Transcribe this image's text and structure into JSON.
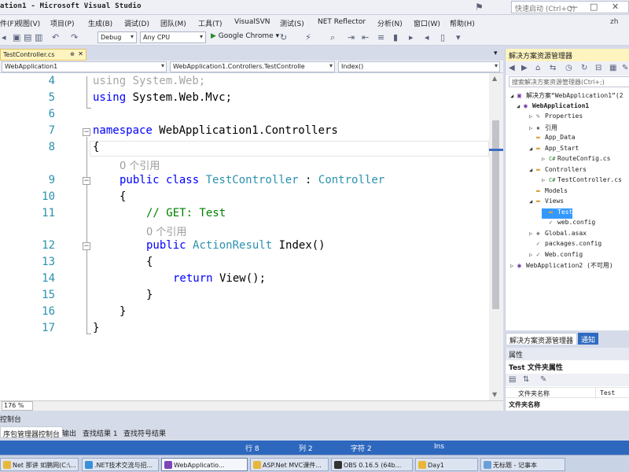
{
  "window": {
    "title": "ation1 - Microsoft Visual Studio",
    "quick_launch_placeholder": "快速启动 (Ctrl+Q)",
    "controls": [
      "—",
      "□",
      "✕"
    ]
  },
  "menu": {
    "items": [
      "件(F)",
      "视图(V)",
      "项目(P)",
      "生成(B)",
      "调试(D)",
      "团队(M)",
      "工具(T)",
      "VisualSVN",
      "测试(S)",
      "NET Reflector",
      "分析(N)",
      "窗口(W)",
      "帮助(H)"
    ],
    "user": "zh"
  },
  "toolbar": {
    "config": "Debug",
    "platform": "Any CPU",
    "run_target": "Google Chrome"
  },
  "editor": {
    "tab_label": "TestController.cs",
    "tab_pin": "⊕",
    "tab_close": "✕",
    "nav_project": "WebApplication1",
    "nav_class": "WebApplication1.Controllers.TestControlle",
    "nav_member": "Index()",
    "zoom": "176 %",
    "lines": [
      {
        "num": "4",
        "segments": [
          {
            "t": "using System.Web;",
            "c": "faded"
          }
        ]
      },
      {
        "num": "5",
        "segments": [
          {
            "t": "using",
            "c": "kw"
          },
          {
            "t": " System.Web.Mvc;",
            "c": ""
          }
        ]
      },
      {
        "num": "6",
        "segments": []
      },
      {
        "num": "7",
        "segments": [
          {
            "t": "namespace",
            "c": "kw"
          },
          {
            "t": " WebApplication1.Controllers",
            "c": ""
          }
        ]
      },
      {
        "num": "8",
        "segments": [
          {
            "t": "{",
            "c": ""
          }
        ]
      },
      {
        "num": "",
        "segments": [
          {
            "t": "0 个引用",
            "c": "cl"
          }
        ]
      },
      {
        "num": "9",
        "segments": [
          {
            "t": "public class ",
            "c": "kw"
          },
          {
            "t": "TestController",
            "c": "ty"
          },
          {
            "t": " : ",
            "c": ""
          },
          {
            "t": "Controller",
            "c": "ty"
          }
        ]
      },
      {
        "num": "10",
        "segments": [
          {
            "t": "{",
            "c": ""
          }
        ]
      },
      {
        "num": "11",
        "segments": [
          {
            "t": "// GET: Test",
            "c": "cm"
          }
        ]
      },
      {
        "num": "",
        "segments": [
          {
            "t": "0 个引用",
            "c": "cl"
          }
        ]
      },
      {
        "num": "12",
        "segments": [
          {
            "t": "public ",
            "c": "kw"
          },
          {
            "t": "ActionResult",
            "c": "ty"
          },
          {
            "t": " Index()",
            "c": ""
          }
        ]
      },
      {
        "num": "13",
        "segments": [
          {
            "t": "{",
            "c": ""
          }
        ]
      },
      {
        "num": "14",
        "segments": [
          {
            "t": "return",
            "c": "kw"
          },
          {
            "t": " View();",
            "c": ""
          }
        ]
      },
      {
        "num": "15",
        "segments": [
          {
            "t": "}",
            "c": ""
          }
        ]
      },
      {
        "num": "16",
        "segments": [
          {
            "t": "}",
            "c": ""
          }
        ]
      },
      {
        "num": "17",
        "segments": [
          {
            "t": "}",
            "c": ""
          }
        ]
      }
    ]
  },
  "solution_explorer": {
    "title": "解决方案资源管理器",
    "search_placeholder": "搜索解决方案资源管理器(Ctrl+;)",
    "tree": [
      {
        "label": "解决方案“WebApplication1”(2",
        "icon": "solution-icon"
      },
      {
        "label": "WebApplication1",
        "icon": "project-icon"
      },
      {
        "label": "Properties",
        "icon": "wrench-icon"
      },
      {
        "label": "引用",
        "icon": "references-icon"
      },
      {
        "label": "App_Data",
        "icon": "folder-icon"
      },
      {
        "label": "App_Start",
        "icon": "folder-icon"
      },
      {
        "label": "RouteConfig.cs",
        "icon": "csharp-file-icon"
      },
      {
        "label": "Controllers",
        "icon": "folder-icon"
      },
      {
        "label": "TestController.cs",
        "icon": "csharp-file-icon"
      },
      {
        "label": "Models",
        "icon": "folder-icon"
      },
      {
        "label": "Views",
        "icon": "folder-icon"
      },
      {
        "label": "Test",
        "icon": "folder-icon"
      },
      {
        "label": "web.config",
        "icon": "config-file-icon"
      },
      {
        "label": "Global.asax",
        "icon": "asax-file-icon"
      },
      {
        "label": "packages.config",
        "icon": "config-file-icon"
      },
      {
        "label": "Web.config",
        "icon": "config-file-icon"
      },
      {
        "label": "WebApplication2 (不可用)",
        "icon": "project-icon"
      }
    ],
    "tab_active": "解决方案资源管理器",
    "tab_other": "通知"
  },
  "properties": {
    "title": "属性",
    "subject": "Test 文件夹属性",
    "row_key": "文件夹名称",
    "row_value": "Test",
    "category": "文件夹名称"
  },
  "console": {
    "label": "控制台"
  },
  "bottom_tabs": [
    "序包管理器控制台",
    "输出",
    "查找结果 1",
    "查找符号结果"
  ],
  "status": {
    "line": "行 8",
    "col": "列 2",
    "ch": "字符 2",
    "mode": "Ins"
  },
  "taskbar": [
    {
      "label": "Net 那讲 如鹏网(C:\\..."
    },
    {
      "label": ".NET技术交流与招..."
    },
    {
      "label": "WebApplicatio..."
    },
    {
      "label": "ASP.Net MVC课件..."
    },
    {
      "label": "OBS 0.16.5 (64b..."
    },
    {
      "label": "Day1"
    },
    {
      "label": "无标题 - 记事本"
    }
  ]
}
